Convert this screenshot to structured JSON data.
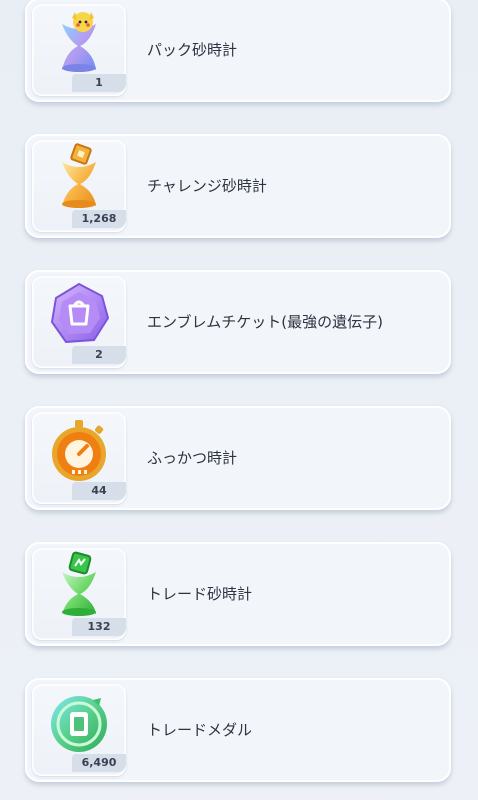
{
  "items": [
    {
      "name": "パック砂時計",
      "count": "1",
      "icon": "pack-hourglass-icon"
    },
    {
      "name": "チャレンジ砂時計",
      "count": "1,268",
      "icon": "challenge-hourglass-icon"
    },
    {
      "name": "エンブレムチケット(最強の遺伝子)",
      "count": "2",
      "icon": "emblem-ticket-icon"
    },
    {
      "name": "ふっかつ時計",
      "count": "44",
      "icon": "revive-clock-icon"
    },
    {
      "name": "トレード砂時計",
      "count": "132",
      "icon": "trade-hourglass-icon"
    },
    {
      "name": "トレードメダル",
      "count": "6,490",
      "icon": "trade-medal-icon"
    }
  ]
}
